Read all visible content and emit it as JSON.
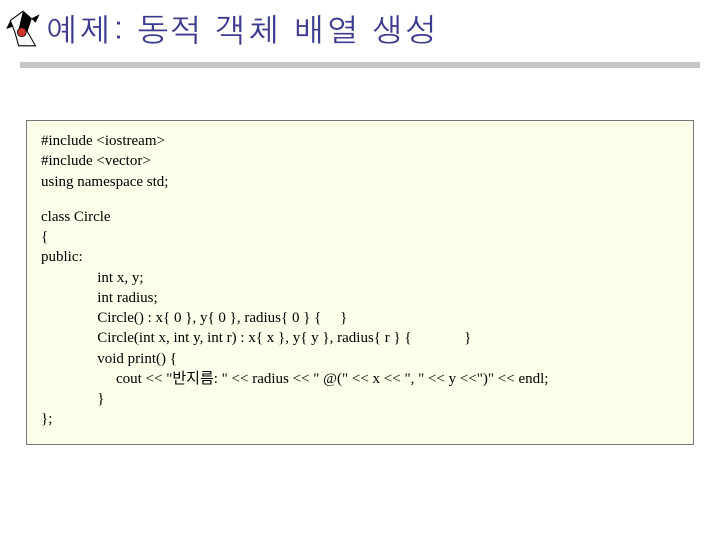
{
  "title": "예제: 동적 객체 배열 생성",
  "logo": {
    "name": "java-duke-icon"
  },
  "code": {
    "l0": "#include <iostream>",
    "l1": "#include <vector>",
    "l2": "using namespace std;",
    "l3": "class Circle",
    "l4": "{",
    "l5": "public:",
    "l6": "               int x, y;",
    "l7": "               int radius;",
    "l8": "               Circle() : x{ 0 }, y{ 0 }, radius{ 0 } {     }",
    "l9": "               Circle(int x, int y, int r) : x{ x }, y{ y }, radius{ r } {              }",
    "l10": "               void print() {",
    "l11": "                    cout << \"반지름: \" << radius << \" @(\" << x << \", \" << y <<\")\" << endl;",
    "l12": "               }",
    "l13": "};"
  }
}
